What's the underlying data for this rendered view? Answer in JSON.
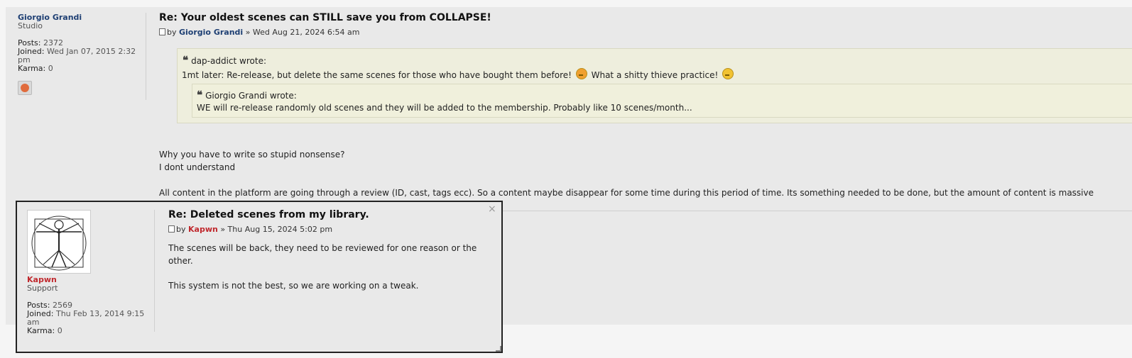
{
  "post": {
    "author": {
      "name": "Giorgio Grandi",
      "rank": "Studio",
      "posts_label": "Posts:",
      "posts": "2372",
      "joined_label": "Joined:",
      "joined": "Wed Jan 07, 2015 2:32 pm",
      "karma_label": "Karma:",
      "karma": "0"
    },
    "title": "Re: Your oldest scenes can STILL save you from COLLAPSE!",
    "by_prefix": "by",
    "by_name": "Giorgio Grandi",
    "by_date": "» Wed Aug 21, 2024 6:54 am",
    "quote_outer": {
      "author_line": "dap-addict wrote:",
      "text_part1": "1mt later: Re-release, but delete the same scenes for those who have bought them before!",
      "text_part2": "What a shitty thieve practice!",
      "quote_inner": {
        "author_line": "Giorgio Grandi wrote:",
        "text": "WE will re-release randomly old scenes and they will be added to the membership. Probably like 10 scenes/month..."
      }
    },
    "body": [
      "Why you have to write so stupid nonsense?",
      "I dont understand",
      "All content in the platform are going through a review (ID, cast, tags ecc). So a content maybe disappear for some time during this period of time. Its something needed to be done, but the amount of content is massive"
    ]
  },
  "popup": {
    "close": "×",
    "author": {
      "name": "Kapwn",
      "rank": "Support",
      "posts_label": "Posts:",
      "posts": "2569",
      "joined_label": "Joined:",
      "joined": "Thu Feb 13, 2014 9:15 am",
      "karma_label": "Karma:",
      "karma": "0"
    },
    "title": "Re: Deleted scenes from my library.",
    "by_prefix": "by",
    "by_name": "Kapwn",
    "by_date": "» Thu Aug 15, 2024 5:02 pm",
    "body": [
      "The scenes will be back, they need to be reviewed for one reason or the other.",
      "This system is not the best, so we are working on a tweak."
    ]
  },
  "icons": {
    "quote": "quote-icon",
    "post": "post-icon",
    "emoji_angry": "angry-emoji-icon",
    "emoji_confused": "confused-emoji-icon",
    "close": "close-icon"
  },
  "colors": {
    "username_blue": "#1e3f73",
    "username_red": "#c0282d",
    "quote_bg": "#eeeedd",
    "post_bg": "#e9e9e9"
  }
}
